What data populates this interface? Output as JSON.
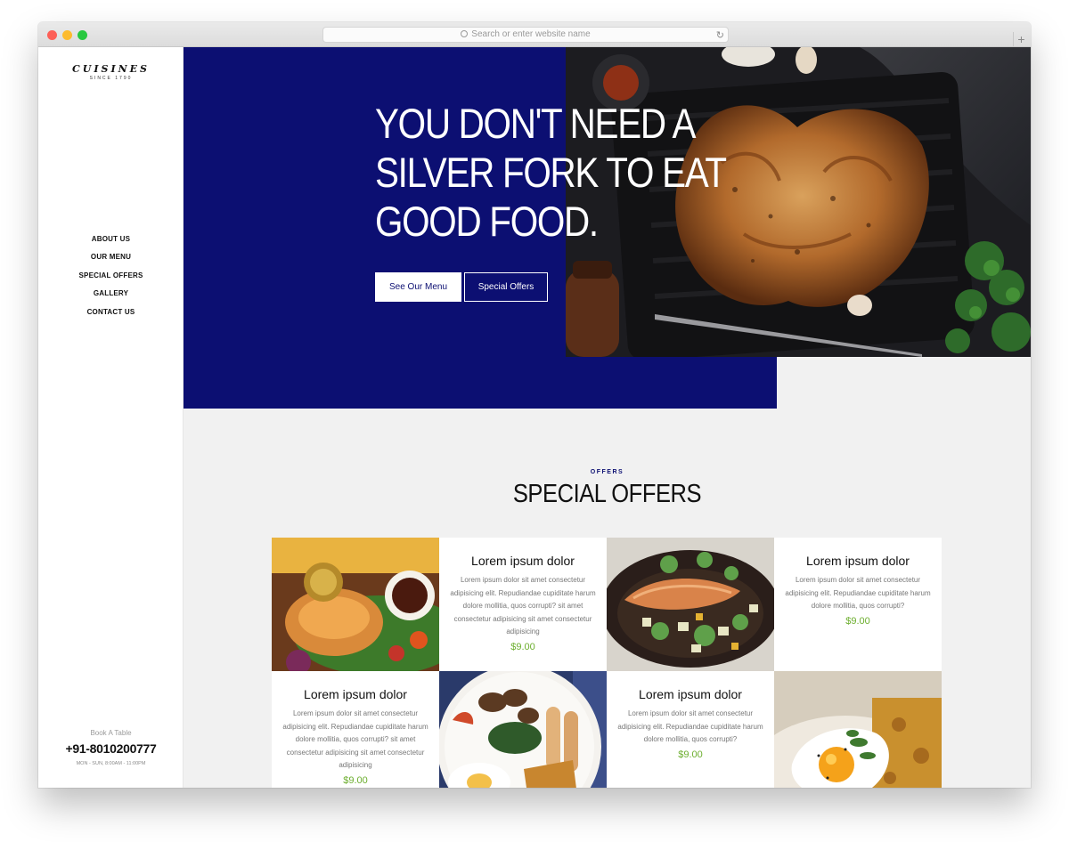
{
  "browser": {
    "address_placeholder": "Search or enter website name"
  },
  "sidebar": {
    "logo_name": "CUISINES",
    "logo_since": "SINCE 1790",
    "nav": [
      "ABOUT US",
      "OUR MENU",
      "SPECIAL OFFERS",
      "GALLERY",
      "CONTACT US"
    ],
    "book_label": "Book A Table",
    "phone": "+91-8010200777",
    "hours": "MON - SUN, 8:00AM - 11:00PM"
  },
  "hero": {
    "title_lines": [
      "YOU DON'T NEED A",
      "SILVER FORK TO EAT",
      "GOOD FOOD."
    ],
    "primary_button": "See Our Menu",
    "secondary_button": "Special Offers",
    "accent_color": "#0c0f72"
  },
  "offers": {
    "eyebrow": "OFFERS",
    "title": "SPECIAL OFFERS",
    "price_color": "#6cae2e",
    "cards": [
      {
        "title": "Lorem ipsum dolor",
        "desc": "Lorem ipsum dolor sit amet consectetur adipisicing elit. Repudiandae cupiditate harum dolore mollitia, quos corrupti? sit amet consectetur adipisicing sit amet consectetur adipisicing",
        "price": "$9.00"
      },
      {
        "title": "Lorem ipsum dolor",
        "desc": "Lorem ipsum dolor sit amet consectetur adipisicing elit. Repudiandae cupiditate harum dolore mollitia, quos corrupti?",
        "price": "$9.00"
      },
      {
        "title": "Lorem ipsum dolor",
        "desc": "Lorem ipsum dolor sit amet consectetur adipisicing elit. Repudiandae cupiditate harum dolore mollitia, quos corrupti? sit amet consectetur adipisicing sit amet consectetur adipisicing",
        "price": "$9.00"
      },
      {
        "title": "Lorem ipsum dolor",
        "desc": "Lorem ipsum dolor sit amet consectetur adipisicing elit. Repudiandae cupiditate harum dolore mollitia, quos corrupti?",
        "price": "$9.00"
      }
    ],
    "images": [
      "salmon-salad-photo",
      "fish-vegetables-photo",
      "english-breakfast-photo",
      "fried-egg-photo"
    ]
  }
}
